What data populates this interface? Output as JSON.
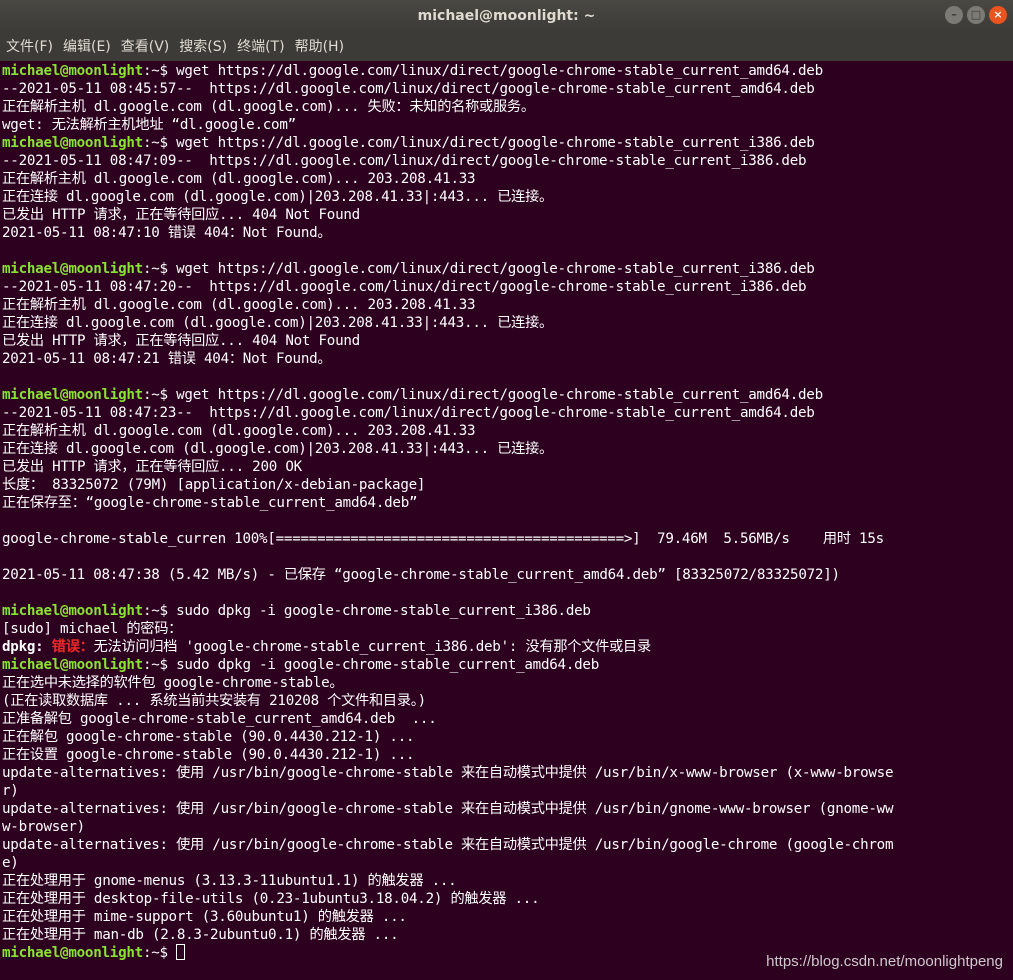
{
  "window": {
    "title": "michael@moonlight: ~",
    "buttons": [
      "–",
      "□",
      "×"
    ]
  },
  "menubar": [
    "文件(F)",
    "编辑(E)",
    "查看(V)",
    "搜索(S)",
    "终端(T)",
    "帮助(H)"
  ],
  "prompt": {
    "user_host": "michael@moonlight",
    "path": ":~$ "
  },
  "cmd": [
    "wget https://dl.google.com/linux/direct/google-chrome-stable_current_amd64.deb",
    "wget https://dl.google.com/linux/direct/google-chrome-stable_current_i386.deb",
    "wget https://dl.google.com/linux/direct/google-chrome-stable_current_i386.deb",
    "wget https://dl.google.com/linux/direct/google-chrome-stable_current_amd64.deb",
    "sudo dpkg -i google-chrome-stable_current_i386.deb",
    "sudo dpkg -i google-chrome-stable_current_amd64.deb"
  ],
  "out": [
    "--2021-05-11 08:45:57--  https://dl.google.com/linux/direct/google-chrome-stable_current_amd64.deb",
    "正在解析主机 dl.google.com (dl.google.com)... 失败：未知的名称或服务。",
    "wget: 无法解析主机地址 “dl.google.com”",
    "--2021-05-11 08:47:09--  https://dl.google.com/linux/direct/google-chrome-stable_current_i386.deb",
    "正在解析主机 dl.google.com (dl.google.com)... 203.208.41.33",
    "正在连接 dl.google.com (dl.google.com)|203.208.41.33|:443... 已连接。",
    "已发出 HTTP 请求，正在等待回应... 404 Not Found",
    "2021-05-11 08:47:10 错误 404：Not Found。",
    "--2021-05-11 08:47:20--  https://dl.google.com/linux/direct/google-chrome-stable_current_i386.deb",
    "正在解析主机 dl.google.com (dl.google.com)... 203.208.41.33",
    "正在连接 dl.google.com (dl.google.com)|203.208.41.33|:443... 已连接。",
    "已发出 HTTP 请求，正在等待回应... 404 Not Found",
    "2021-05-11 08:47:21 错误 404：Not Found。",
    "--2021-05-11 08:47:23--  https://dl.google.com/linux/direct/google-chrome-stable_current_amd64.deb",
    "正在解析主机 dl.google.com (dl.google.com)... 203.208.41.33",
    "正在连接 dl.google.com (dl.google.com)|203.208.41.33|:443... 已连接。",
    "已发出 HTTP 请求，正在等待回应... 200 OK",
    "长度： 83325072 (79M) [application/x-debian-package]",
    "正在保存至：“google-chrome-stable_current_amd64.deb”",
    "google-chrome-stable_curren 100%[==========================================>]  79.46M  5.56MB/s    用时 15s",
    "2021-05-11 08:47:38 (5.42 MB/s) - 已保存 “google-chrome-stable_current_amd64.deb” [83325072/83325072])",
    "[sudo] michael 的密码：",
    "无法访问归档 'google-chrome-stable_current_i386.deb': 没有那个文件或目录",
    "正在选中未选择的软件包 google-chrome-stable。",
    "(正在读取数据库 ... 系统当前共安装有 210208 个文件和目录。)",
    "正准备解包 google-chrome-stable_current_amd64.deb  ...",
    "正在解包 google-chrome-stable (90.0.4430.212-1) ...",
    "正在设置 google-chrome-stable (90.0.4430.212-1) ...",
    "update-alternatives: 使用 /usr/bin/google-chrome-stable 来在自动模式中提供 /usr/bin/x-www-browser (x-www-browse",
    "r)",
    "update-alternatives: 使用 /usr/bin/google-chrome-stable 来在自动模式中提供 /usr/bin/gnome-www-browser (gnome-ww",
    "w-browser)",
    "update-alternatives: 使用 /usr/bin/google-chrome-stable 来在自动模式中提供 /usr/bin/google-chrome (google-chrom",
    "e)",
    "正在处理用于 gnome-menus (3.13.3-11ubuntu1.1) 的触发器 ...",
    "正在处理用于 desktop-file-utils (0.23-1ubuntu3.18.04.2) 的触发器 ...",
    "正在处理用于 mime-support (3.60ubuntu1) 的触发器 ...",
    "正在处理用于 man-db (2.8.3-2ubuntu0.1) 的触发器 ..."
  ],
  "dpkg_error": {
    "prefix": "dpkg: ",
    "label": "错误："
  },
  "watermark": "https://blog.csdn.net/moonlightpeng"
}
